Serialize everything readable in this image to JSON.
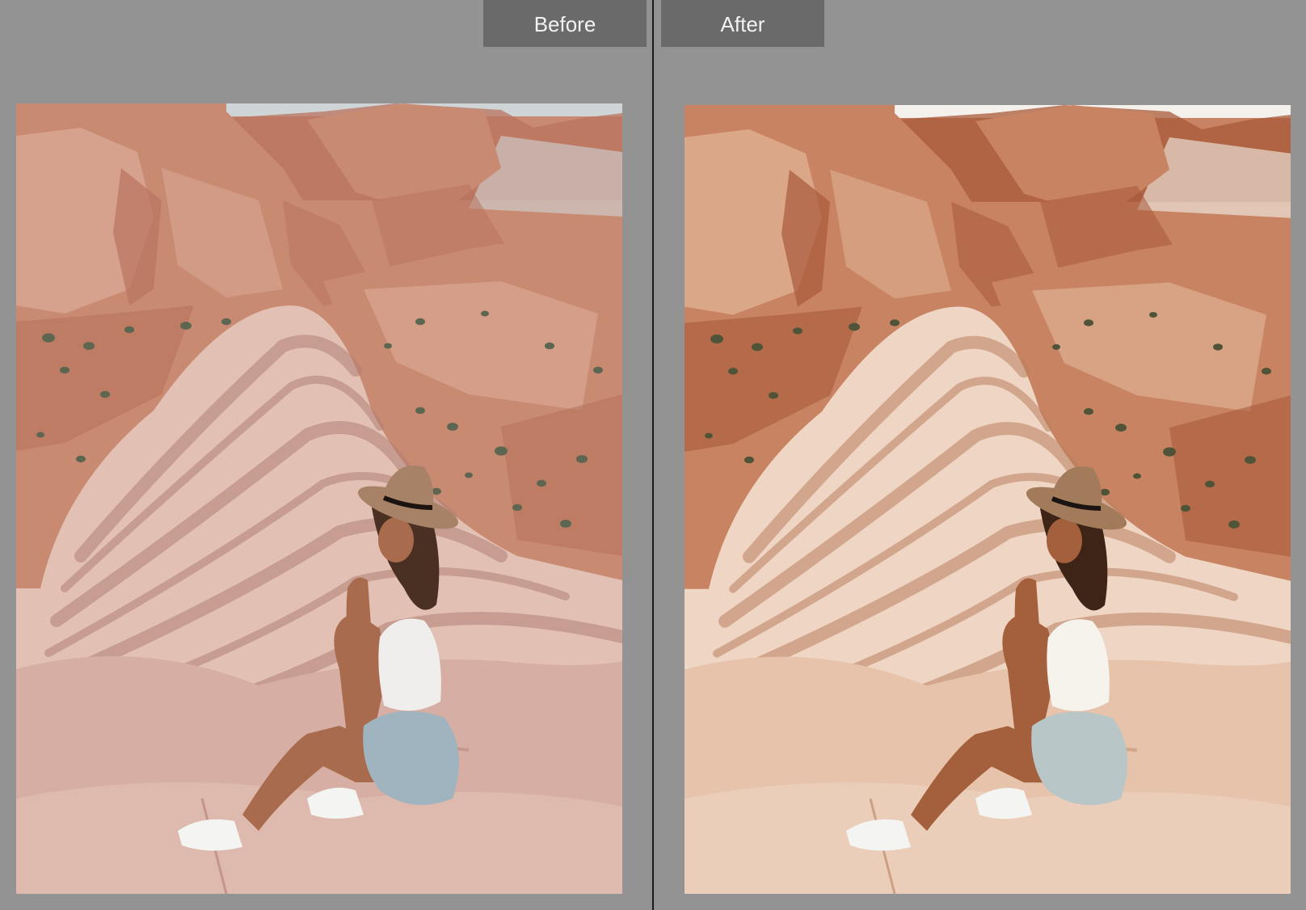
{
  "compare_view": {
    "before": {
      "label": "Before",
      "palette": {
        "sky": "#cfd4d6",
        "rock_dark": "#b8735e",
        "rock_mid": "#c98a72",
        "rock_light": "#d9a693",
        "swirl_light": "#e3c0b4",
        "swirl_dark": "#b07d74",
        "foreground": "#d7aea3",
        "shrub": "#5d6650",
        "shorts": "#9fb4be",
        "skin": "#a86b4d",
        "hat": "#a88266",
        "top": "#f0eeec",
        "hair": "#4a3022"
      }
    },
    "after": {
      "label": "After",
      "palette": {
        "sky": "#f4f1ec",
        "rock_dark": "#a85a3a",
        "rock_mid": "#c88462",
        "rock_light": "#deb093",
        "swirl_light": "#efd6c4",
        "swirl_dark": "#b9805f",
        "foreground": "#e6c3aa",
        "shrub": "#4f5438",
        "shorts": "#b8c6c8",
        "skin": "#a4603c",
        "hat": "#a27b5a",
        "top": "#f6f2ec",
        "hair": "#3d2416"
      }
    }
  }
}
